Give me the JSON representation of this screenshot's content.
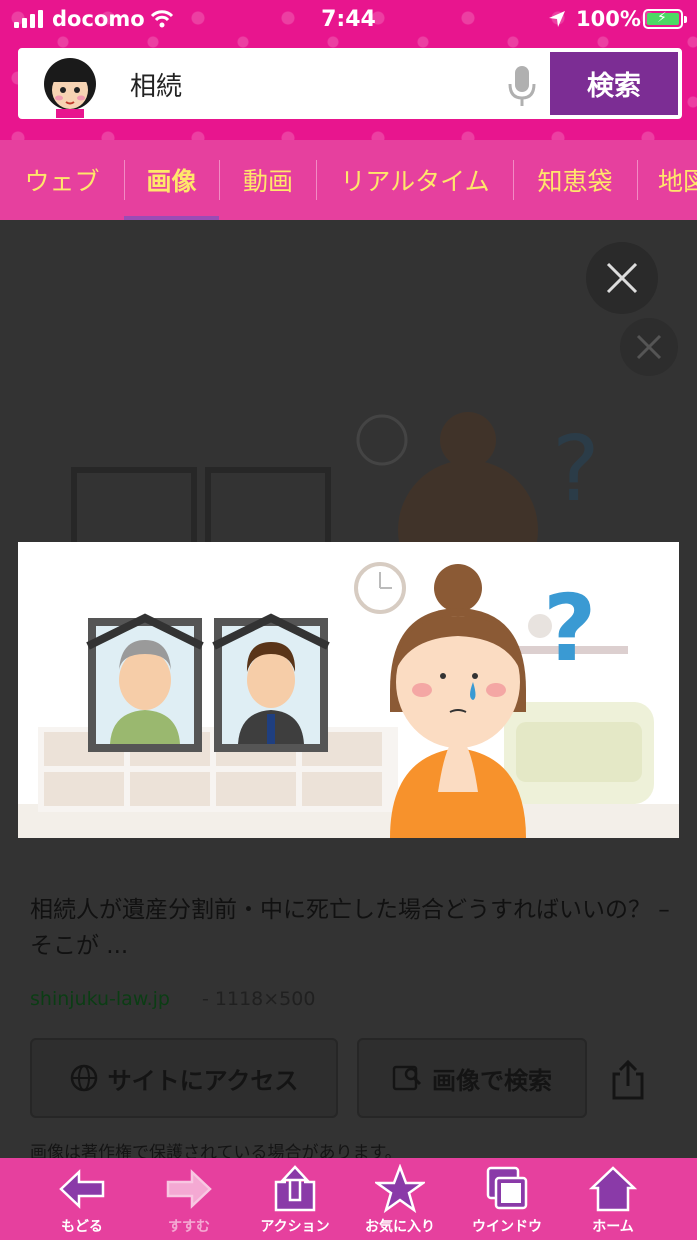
{
  "status_bar": {
    "carrier": "docomo",
    "time": "7:44",
    "battery_percent": "100%"
  },
  "search": {
    "query": "相続",
    "button_label": "検索"
  },
  "tabs": [
    {
      "label": "ウェブ"
    },
    {
      "label": "画像",
      "active": true
    },
    {
      "label": "動画"
    },
    {
      "label": "リアルタイム"
    },
    {
      "label": "知恵袋"
    },
    {
      "label": "地図"
    }
  ],
  "result": {
    "title": "相続人が遺産分割前・中に死亡した場合どうすればいいの？ – そこが ...",
    "source": "shinjuku-law.jp",
    "dimensions": "- 1118×500",
    "visit_site_label": "サイトにアクセス",
    "search_by_image_label": "画像で検索",
    "copyright_note": "画像は著作権で保護されている場合があります。"
  },
  "toolbar": [
    {
      "label": "もどる",
      "icon": "back-arrow-icon"
    },
    {
      "label": "すすむ",
      "icon": "forward-arrow-icon"
    },
    {
      "label": "アクション",
      "icon": "share-icon"
    },
    {
      "label": "お気に入り",
      "icon": "star-icon"
    },
    {
      "label": "ウインドウ",
      "icon": "windows-icon"
    },
    {
      "label": "ホーム",
      "icon": "home-icon"
    }
  ],
  "colors": {
    "brand_pink": "#e8158e",
    "tab_text": "#ffe66b",
    "search_button": "#7c2d94"
  }
}
